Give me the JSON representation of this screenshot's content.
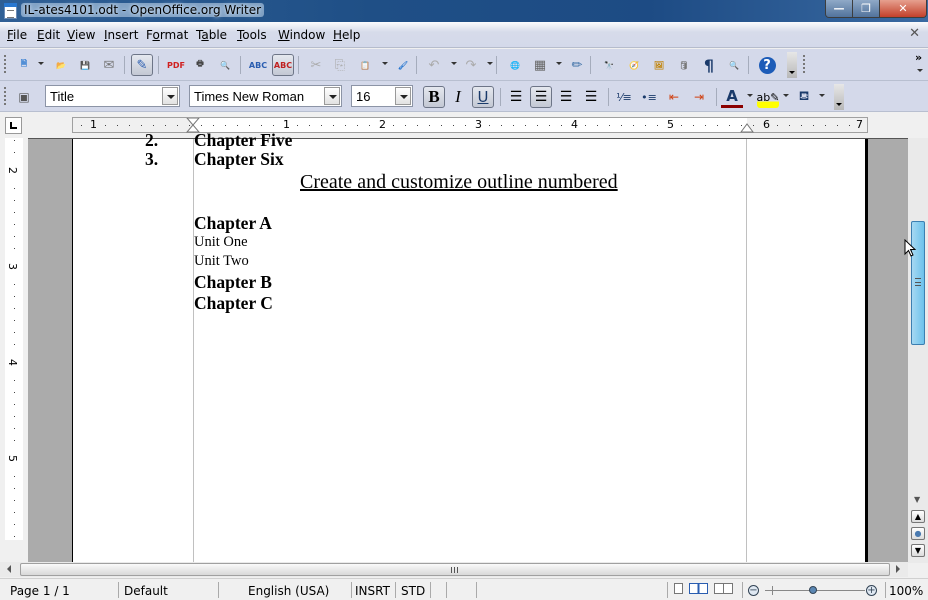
{
  "window": {
    "title": "IL-ates4101.odt - OpenOffice.org Writer",
    "minimize_glyph": "—",
    "restore_glyph": "❐",
    "close_glyph": "✕"
  },
  "menubar": {
    "items": [
      {
        "label": "File",
        "accel": "F"
      },
      {
        "label": "Edit",
        "accel": "E"
      },
      {
        "label": "View",
        "accel": "V"
      },
      {
        "label": "Insert",
        "accel": "I"
      },
      {
        "label": "Format",
        "accel": "o"
      },
      {
        "label": "Table",
        "accel": "a"
      },
      {
        "label": "Tools",
        "accel": "T"
      },
      {
        "label": "Window",
        "accel": "W"
      },
      {
        "label": "Help",
        "accel": "H"
      }
    ],
    "close_doc_glyph": "✕"
  },
  "standard_toolbar": {
    "buttons": [
      {
        "name": "new-document",
        "glyph": "🗎",
        "color": "#2a78d0"
      },
      {
        "name": "open",
        "glyph": "📂",
        "color": "#e0a000"
      },
      {
        "name": "save",
        "glyph": "💾",
        "color": "#999999"
      },
      {
        "name": "email-document",
        "glyph": "✉",
        "color": "#777777"
      },
      {
        "name": "edit-file",
        "glyph": "✎",
        "color": "#2a5db0"
      },
      {
        "name": "export-pdf",
        "glyph": "PDF",
        "color": "#d02020"
      },
      {
        "name": "print",
        "glyph": "🖶",
        "color": "#444444"
      },
      {
        "name": "page-preview",
        "glyph": "🔍",
        "color": "#3a6ea5"
      },
      {
        "name": "spellcheck",
        "glyph": "ABC",
        "color": "#2a5db0"
      },
      {
        "name": "autospellcheck",
        "glyph": "ABC",
        "color": "#c02020"
      },
      {
        "name": "cut",
        "glyph": "✂",
        "color": "#aaaaaa"
      },
      {
        "name": "copy",
        "glyph": "⎘",
        "color": "#aaaaaa"
      },
      {
        "name": "paste",
        "glyph": "📋",
        "color": "#c08000"
      },
      {
        "name": "clone-formatting",
        "glyph": "🖌",
        "color": "#2a78d0"
      },
      {
        "name": "undo",
        "glyph": "↶",
        "color": "#aaaaaa"
      },
      {
        "name": "redo",
        "glyph": "↷",
        "color": "#aaaaaa"
      },
      {
        "name": "hyperlink",
        "glyph": "🌐",
        "color": "#3a8a3a"
      },
      {
        "name": "table",
        "glyph": "▦",
        "color": "#666666"
      },
      {
        "name": "show-draw-functions",
        "glyph": "✏",
        "color": "#3a6ea5"
      },
      {
        "name": "find-replace",
        "glyph": "🔭",
        "color": "#222222"
      },
      {
        "name": "navigator",
        "glyph": "🧭",
        "color": "#d02020"
      },
      {
        "name": "gallery",
        "glyph": "🖼",
        "color": "#c08000"
      },
      {
        "name": "data-sources",
        "glyph": "🛢",
        "color": "#777777"
      },
      {
        "name": "nonprinting-characters",
        "glyph": "¶",
        "color": "#1a3a6a"
      },
      {
        "name": "zoom",
        "glyph": "🔍",
        "color": "#3a6ea5"
      },
      {
        "name": "help",
        "glyph": "?",
        "color": "#1d5cb8"
      }
    ],
    "more_glyph": "»"
  },
  "formatting_toolbar": {
    "paragraph_style": "Title",
    "font_name": "Times New Roman",
    "font_size": "16",
    "bold_glyph": "B",
    "italic_glyph": "I",
    "underline_glyph": "U",
    "align_buttons": [
      "align-left",
      "align-center",
      "align-right",
      "justify"
    ],
    "list_buttons": [
      "numbering",
      "bullets",
      "decrease-indent",
      "increase-indent"
    ],
    "font_color": "#8b0000",
    "highlight_color": "#ffff00",
    "active": {
      "bold": true,
      "underline": true,
      "align_center": true
    }
  },
  "ruler": {
    "horizontal_labels": [
      "1",
      "1",
      "2",
      "3",
      "4",
      "5",
      "6",
      "7"
    ],
    "vertical_labels": [
      "2",
      "3",
      "4",
      "5"
    ]
  },
  "document": {
    "lines": [
      {
        "number": "2.",
        "text": "Chapter Five",
        "style": "heading"
      },
      {
        "number": "3.",
        "text": "Chapter Six",
        "style": "heading"
      },
      {
        "number": "",
        "text": "Create and customize outline numbered",
        "style": "title"
      },
      {
        "number": "",
        "text": "Chapter A",
        "style": "heading"
      },
      {
        "number": "",
        "text": "Unit One",
        "style": "normal"
      },
      {
        "number": "",
        "text": "Unit Two",
        "style": "normal"
      },
      {
        "number": "",
        "text": "Chapter B",
        "style": "heading"
      },
      {
        "number": "",
        "text": "Chapter C",
        "style": "heading"
      }
    ]
  },
  "statusbar": {
    "page": "Page 1 / 1",
    "page_style": "Default",
    "language": "English (USA)",
    "insert_mode": "INSRT",
    "selection_mode": "STD",
    "zoom_level": "100%",
    "zoom_out_glyph": "−",
    "zoom_in_glyph": "+"
  },
  "scroll": {
    "vertical_position_fraction": 0.3,
    "prev_page_glyph": "▲",
    "navigate_glyph": "●",
    "next_page_glyph": "▼",
    "hgrip_glyph": "|||"
  }
}
